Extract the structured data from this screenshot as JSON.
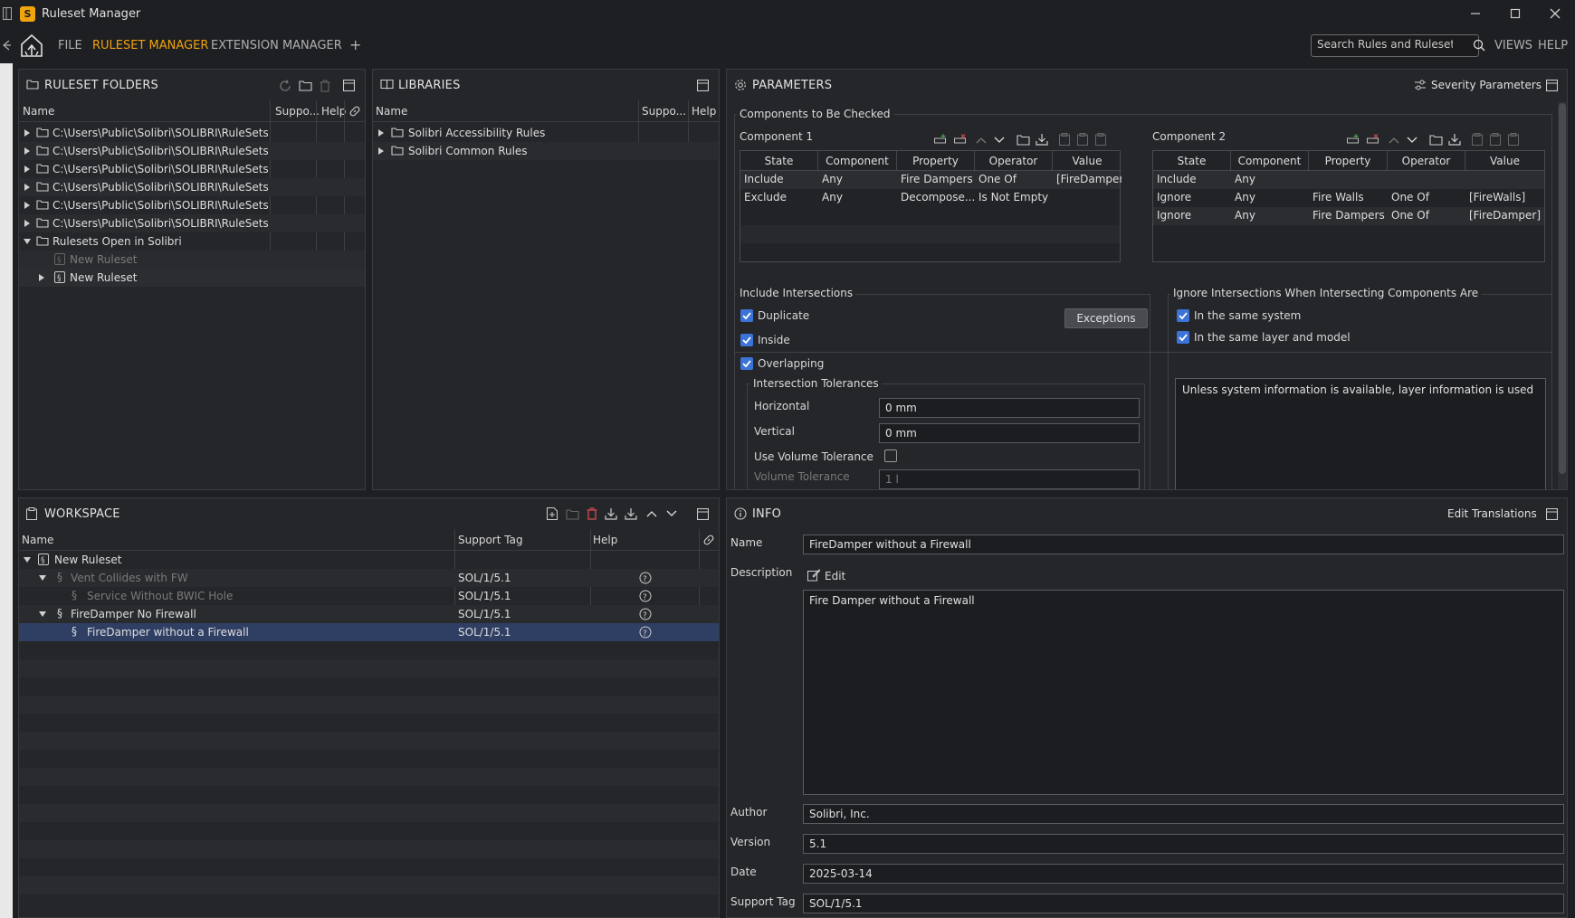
{
  "window": {
    "title": "Ruleset Manager",
    "logo_letter": "S"
  },
  "menu": {
    "file": "FILE",
    "ruleset_manager": "RULESET MANAGER",
    "extension_manager": "EXTENSION MANAGER",
    "add": "+",
    "views": "VIEWS",
    "help": "HELP"
  },
  "search": {
    "placeholder": "Search Rules and Rulesets"
  },
  "ruleset_folders": {
    "title": "RULESET FOLDERS",
    "columns": {
      "name": "Name",
      "support": "Suppo...",
      "help": "Help"
    },
    "rows": [
      "C:\\Users\\Public\\Solibri\\SOLIBRI\\RuleSets",
      "C:\\Users\\Public\\Solibri\\SOLIBRI\\RuleSets\\",
      "C:\\Users\\Public\\Solibri\\SOLIBRI\\RuleSets\\",
      "C:\\Users\\Public\\Solibri\\SOLIBRI\\RuleSets\\",
      "C:\\Users\\Public\\Solibri\\SOLIBRI\\RuleSets\\",
      "C:\\Users\\Public\\Solibri\\SOLIBRI\\RuleSets\\"
    ],
    "open_folder": "Rulesets Open in Solibri",
    "open_items": [
      "New Ruleset",
      "New Ruleset"
    ]
  },
  "libraries": {
    "title": "LIBRARIES",
    "columns": {
      "name": "Name",
      "support": "Suppo...",
      "help": "Help"
    },
    "rows": [
      "Solibri Accessibility Rules",
      "Solibri Common Rules"
    ]
  },
  "parameters": {
    "title": "PARAMETERS",
    "severity": "Severity Parameters",
    "components_group": "Components to Be Checked",
    "comp1": {
      "title": "Component 1",
      "columns": [
        "State",
        "Component",
        "Property",
        "Operator",
        "Value"
      ],
      "rows": [
        [
          "Include",
          "Any",
          "Fire Dampers",
          "One Of",
          "[FireDamper]"
        ],
        [
          "Exclude",
          "Any",
          "Decompose...",
          "Is Not Empty",
          ""
        ]
      ]
    },
    "comp2": {
      "title": "Component 2",
      "columns": [
        "State",
        "Component",
        "Property",
        "Operator",
        "Value"
      ],
      "rows": [
        [
          "Include",
          "Any",
          "",
          "",
          ""
        ],
        [
          "Ignore",
          "Any",
          "Fire Walls",
          "One Of",
          "[FireWalls]"
        ],
        [
          "Ignore",
          "Any",
          "Fire Dampers",
          "One Of",
          "[FireDamper]"
        ]
      ]
    },
    "include_intersections": {
      "title": "Include Intersections",
      "duplicate": "Duplicate",
      "inside": "Inside",
      "overlapping": "Overlapping",
      "exceptions": "Exceptions",
      "tolerances": "Intersection Tolerances",
      "horizontal_label": "Horizontal",
      "horizontal_value": "0 mm",
      "vertical_label": "Vertical",
      "vertical_value": "0 mm",
      "use_volume": "Use Volume Tolerance",
      "volume_label": "Volume Tolerance",
      "volume_value": "1 l"
    },
    "ignore_intersections": {
      "title": "Ignore Intersections When Intersecting Components Are",
      "same_system": "In the same system",
      "same_layer": "In the same layer and model",
      "note": "Unless system information is available, layer information is used"
    }
  },
  "workspace": {
    "title": "WORKSPACE",
    "columns": {
      "name": "Name",
      "support": "Support Tag",
      "help": "Help"
    },
    "rows": [
      {
        "name": "New Ruleset",
        "tag": ""
      },
      {
        "name": "Vent Collides with FW",
        "tag": "SOL/1/5.1"
      },
      {
        "name": "Service Without BWIC Hole",
        "tag": "SOL/1/5.1"
      },
      {
        "name": "FireDamper No Firewall",
        "tag": "SOL/1/5.1"
      },
      {
        "name": "FireDamper without a Firewall",
        "tag": "SOL/1/5.1"
      }
    ]
  },
  "info": {
    "title": "INFO",
    "edit_translations": "Edit Translations",
    "name_label": "Name",
    "name_value": "FireDamper without a Firewall",
    "description_label": "Description",
    "edit": "Edit",
    "description_value": "Fire Damper without a Firewall",
    "author_label": "Author",
    "author_value": "Solibri, Inc.",
    "version_label": "Version",
    "version_value": "5.1",
    "date_label": "Date",
    "date_value": "2025-03-14",
    "support_label": "Support Tag",
    "support_value": "SOL/1/5.1"
  },
  "colors": {
    "accent": "#f0a30a",
    "selection": "#2f3e63",
    "checkbox": "#3b73d6",
    "panel": "#25262a",
    "background": "#1e1f22"
  }
}
